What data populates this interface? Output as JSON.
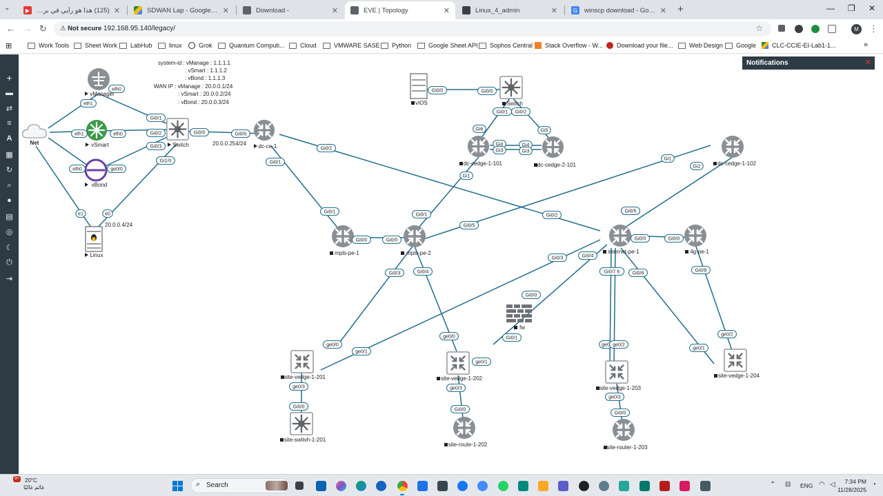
{
  "browser": {
    "tabs": [
      {
        "title": "(125) هذا هو رأيي في برنامج دولة",
        "fav": "#e53935"
      },
      {
        "title": "SDWAN Lap - Google Drive",
        "fav": "#1e8e3e"
      },
      {
        "title": "Download -",
        "fav": "#5f6368"
      },
      {
        "title": "EVE | Topology",
        "fav": "#5f6368"
      },
      {
        "title": "Linux_4_admin",
        "fav": "#3c4043"
      },
      {
        "title": "winscp download - Google Sea",
        "fav": "#4285f4"
      }
    ],
    "security_label": "Not secure",
    "url": "192.168.95.140/legacy/",
    "avatar_letter": "M",
    "bookmarks": [
      "Work Tools",
      "Sheet Work",
      "LabHub",
      "linux",
      "Grok",
      "Quantum Computi...",
      "Cloud",
      "VMWARE SASE",
      "Python",
      "Google Sheet API",
      "Sophos Central",
      "Stack Overflow - W...",
      "Download your file...",
      "Web Design",
      "Google",
      "CLC-CCIE-EI-Lab1-1..."
    ]
  },
  "notifications": {
    "title": "Notifications"
  },
  "info_text": [
    "system-id : vManage : 1.1.1.1",
    ": vSmart   : 1.1.1.2",
    ": vBond    : 1.1.1.3",
    "WAN IP : vManage : 20.0.0.1/24",
    ": vSmart   : 20.0.0.2/24",
    ": vBond    : 20.0.0.3/24"
  ],
  "ip_labels": {
    "switch_ip": "20.0.0.254/24",
    "linux_ip": "20.0.0.4/24"
  },
  "nodes": {
    "net": "Net",
    "vmanager": "vManager",
    "vsmart": "vSmart",
    "vbond": "vBond",
    "switch_main": "Switch",
    "linux": "Linux",
    "dc_ce_1": "dc-ce-1",
    "vios": "vIOS",
    "switch_top": "Switch",
    "dc_cedge_1_101": "dc-cedge-1-101",
    "dc_cedge_2_101": "dc-cedge-2-101",
    "dc_cedge_1_102": "dc-cedge-1-102",
    "mpls_pe_1": "mpls-pe-1",
    "mpls_pe_2": "mpls-pe-2",
    "internet_pe_1": "internet-pe-1",
    "pe_4g_1": "4g-pe-1",
    "fw": "fw",
    "site_vedge_1_201": "site-vedge-1-201",
    "site_vedge_1_202": "site-vedge-1-202",
    "site_vedge_1_203": "site-vedge-1-203",
    "site_vedge_1_204": "site-vedge-1-204",
    "site_switvh_1_201": "site-switvh-1-201",
    "site_route_1_202": "site-route-1-202",
    "site_router_1_203": "site-router-1-203"
  },
  "interfaces": {
    "vmanager_eth0": "eth0",
    "net_eth1_a": "eth1",
    "net_eth1_b": "eth1",
    "vsmart_eth0": "eth0",
    "vbond_eth0": "eth0",
    "vbond_ge00": "ge0/0",
    "sw_gi01": "Gi0/1",
    "sw_gi02": "Gi0/2",
    "sw_gi03": "Gi0/3",
    "sw_gi10": "Gi1/0",
    "sw_gi00": "Gi0/0",
    "dcce_gi00": "Gi0/0",
    "net_e1": "e1",
    "linux_e0": "e0",
    "dcce_gi02": "Gi0/2",
    "dcce_gi01": "Gi0/1",
    "vios_gi00": "Gi0/0",
    "swt_gi00": "Gi0/0",
    "swt_gi01": "Gi0/1",
    "swt_gi02": "Gi0/2",
    "swt_gi5": "Gi5",
    "swt_gi6": "Gi6",
    "c101_gi4": "Gi4",
    "c101_gi3": "Gi3",
    "c201_gi4": "Gi4",
    "c201_gi3": "Gi3",
    "c101_gi1": "Gi1",
    "c102_gi1": "Gi1",
    "c102_gi2": "Gi2",
    "mpls1_gi01": "Gi0/1",
    "mpls1_gi00": "Gi0/0",
    "mpls2_gi00": "Gi0/0",
    "mpls2_gi01": "Gi0/1",
    "mpls2_gi05": "Gi0/5",
    "mpls2_gi03": "Gi0/3",
    "mpls2_gi04": "Gi0/4",
    "inet_gi02": "Gi0/2",
    "inet_gi05": "Gi0/5",
    "inet_gi00": "Gi0/0",
    "pe4g_gi00": "Gi0/0",
    "inet_gi03": "Gi0/3",
    "inet_gi04": "Gi0/4",
    "inet_gi076": "Gi0/7 6",
    "inet_gi08": "Gi0/8",
    "pe4g_gi08": "Gi0/8",
    "fw_gi00": "Gi0/0",
    "fw_gi01": "Gi0/1",
    "v201_ge00": "ge0/0",
    "v201_ge01": "ge0/1",
    "v201_ge03": "ge0/3",
    "sw201_gi00": "Gi0/0",
    "v202_ge00": "ge0/0",
    "v202_ge01": "ge0/1",
    "v202_ge03": "ge0/3",
    "r202_gi00": "Gi0/0",
    "v203_ge0": "ge0",
    "v203_ge02": "ge0/2",
    "v203_ge03": "ge0/3",
    "r203_gi00": "Gi0/0",
    "v204_ge01": "ge0/1",
    "v204_ge02": "ge0/2"
  },
  "taskbar": {
    "weather_temp": "20°C",
    "weather_desc": "غائم غالبًا",
    "notif_count": "9+",
    "search_label": "Search",
    "lang": "ENG",
    "time": "7:34 PM",
    "date": "11/28/2025"
  },
  "colors": {
    "link": "#1f6d8c",
    "sidebar": "#2e3b44",
    "node": "#8a8f94"
  }
}
